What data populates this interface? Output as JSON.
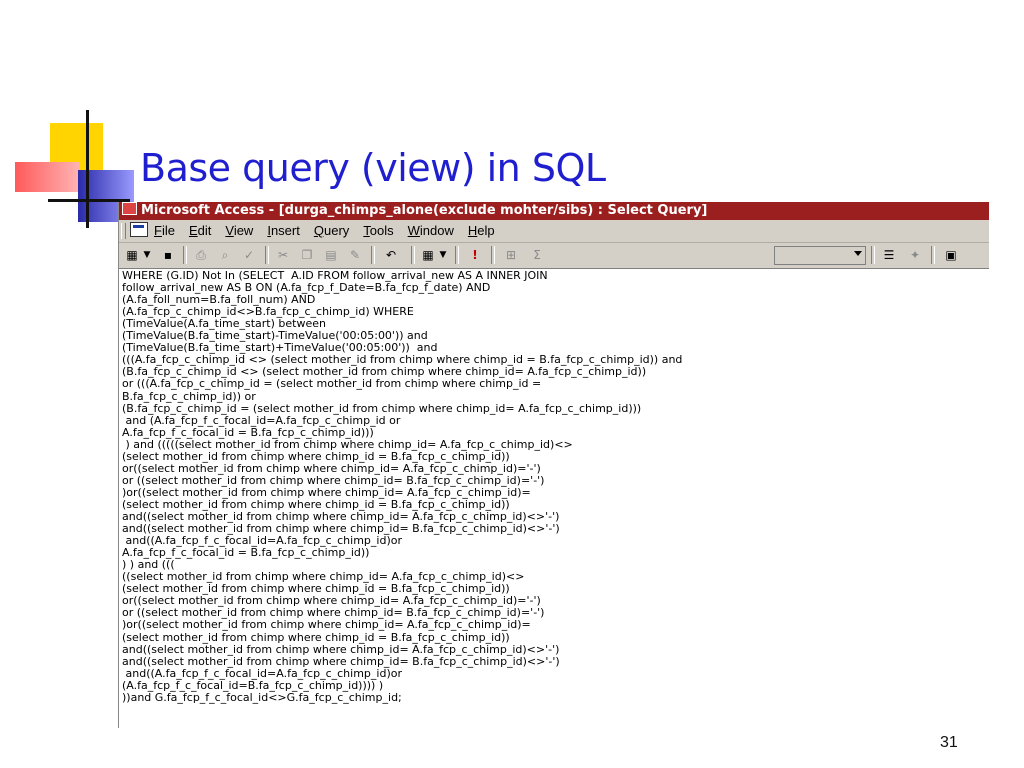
{
  "slide": {
    "title": "Base query (view) in SQL",
    "page_number": "31"
  },
  "window": {
    "title": "Microsoft Access - [durga_chimps_alone(exclude mohter/sibs) : Select Query]"
  },
  "menu": {
    "items": [
      {
        "u": "F",
        "rest": "ile"
      },
      {
        "u": "E",
        "rest": "dit"
      },
      {
        "u": "V",
        "rest": "iew"
      },
      {
        "u": "I",
        "rest": "nsert"
      },
      {
        "u": "Q",
        "rest": "uery"
      },
      {
        "u": "T",
        "rest": "ools"
      },
      {
        "u": "W",
        "rest": "indow"
      },
      {
        "u": "H",
        "rest": "elp"
      }
    ]
  },
  "toolbar": {
    "icons": [
      "view-icon",
      "dropdown-arrow-icon",
      "save-icon",
      "print-icon",
      "print-preview-icon",
      "spelling-icon",
      "cut-icon",
      "copy-icon",
      "paste-icon",
      "format-painter-icon",
      "undo-icon",
      "query-type-icon",
      "dropdown-arrow-icon",
      "run-icon",
      "show-table-icon",
      "totals-icon",
      "top-values-combo",
      "properties-icon",
      "build-icon",
      "database-window-icon"
    ]
  },
  "sql": {
    "lines": [
      "WHERE (G.ID) Not In (SELECT  A.ID FROM follow_arrival_new AS A INNER JOIN",
      "follow_arrival_new AS B ON (A.fa_fcp_f_Date=B.fa_fcp_f_date) AND",
      "(A.fa_foll_num=B.fa_foll_num) AND",
      "(A.fa_fcp_c_chimp_id<>B.fa_fcp_c_chimp_id) WHERE",
      "(TimeValue(A.fa_time_start) between",
      "(TimeValue(B.fa_time_start)-TimeValue('00:05:00')) and",
      "(TimeValue(B.fa_time_start)+TimeValue('00:05:00'))  and",
      "(((A.fa_fcp_c_chimp_id <> (select mother_id from chimp where chimp_id = B.fa_fcp_c_chimp_id)) and",
      "(B.fa_fcp_c_chimp_id <> (select mother_id from chimp where chimp_id= A.fa_fcp_c_chimp_id))",
      "or (((A.fa_fcp_c_chimp_id = (select mother_id from chimp where chimp_id =",
      "B.fa_fcp_c_chimp_id)) or",
      "(B.fa_fcp_c_chimp_id = (select mother_id from chimp where chimp_id= A.fa_fcp_c_chimp_id)))",
      " and (A.fa_fcp_f_c_focal_id=A.fa_fcp_c_chimp_id or",
      "A.fa_fcp_f_c_focal_id = B.fa_fcp_c_chimp_id)))",
      " ) and (((((select mother_id from chimp where chimp_id= A.fa_fcp_c_chimp_id)<>",
      "(select mother_id from chimp where chimp_id = B.fa_fcp_c_chimp_id))",
      "or((select mother_id from chimp where chimp_id= A.fa_fcp_c_chimp_id)='-')",
      "or ((select mother_id from chimp where chimp_id= B.fa_fcp_c_chimp_id)='-')",
      ")or((select mother_id from chimp where chimp_id= A.fa_fcp_c_chimp_id)=",
      "(select mother_id from chimp where chimp_id = B.fa_fcp_c_chimp_id))",
      "and((select mother_id from chimp where chimp_id= A.fa_fcp_c_chimp_id)<>'-')",
      "and((select mother_id from chimp where chimp_id= B.fa_fcp_c_chimp_id)<>'-')",
      " and((A.fa_fcp_f_c_focal_id=A.fa_fcp_c_chimp_id)or",
      "A.fa_fcp_f_c_focal_id = B.fa_fcp_c_chimp_id))",
      ") ) and (((",
      "((select mother_id from chimp where chimp_id= A.fa_fcp_c_chimp_id)<>",
      "(select mother_id from chimp where chimp_id = B.fa_fcp_c_chimp_id))",
      "or((select mother_id from chimp where chimp_id= A.fa_fcp_c_chimp_id)='-')",
      "or ((select mother_id from chimp where chimp_id= B.fa_fcp_c_chimp_id)='-')",
      ")or((select mother_id from chimp where chimp_id= A.fa_fcp_c_chimp_id)=",
      "(select mother_id from chimp where chimp_id = B.fa_fcp_c_chimp_id))",
      "and((select mother_id from chimp where chimp_id= A.fa_fcp_c_chimp_id)<>'-')",
      "and((select mother_id from chimp where chimp_id= B.fa_fcp_c_chimp_id)<>'-')",
      " and((A.fa_fcp_f_c_focal_id=A.fa_fcp_c_chimp_id)or",
      "(A.fa_fcp_f_c_focal_id=B.fa_fcp_c_chimp_id)))) )",
      "))and G.fa_fcp_f_c_focal_id<>G.fa_fcp_c_chimp_id;"
    ]
  }
}
